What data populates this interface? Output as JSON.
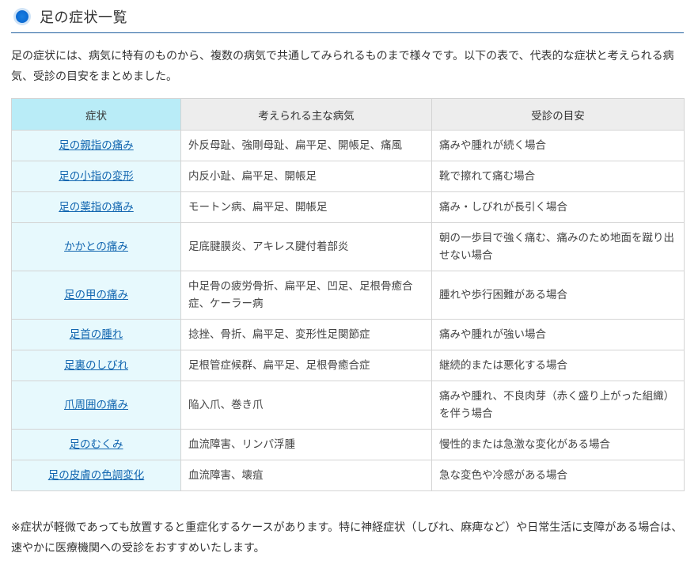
{
  "heading": {
    "title": "足の症状一覧"
  },
  "intro": "足の症状には、病気に特有のものから、複数の病気で共通してみられるものまで様々です。以下の表で、代表的な症状と考えられる病気、受診の目安をまとめました。",
  "table": {
    "headers": [
      "症状",
      "考えられる主な病気",
      "受診の目安"
    ],
    "rows": [
      {
        "symptom": "足の親指の痛み",
        "diseases": "外反母趾、強剛母趾、扁平足、開帳足、痛風",
        "guide": "痛みや腫れが続く場合"
      },
      {
        "symptom": "足の小指の変形",
        "diseases": "内反小趾、扁平足、開帳足",
        "guide": "靴で擦れて痛む場合"
      },
      {
        "symptom": "足の薬指の痛み",
        "diseases": "モートン病、扁平足、開帳足",
        "guide": "痛み・しびれが長引く場合"
      },
      {
        "symptom": "かかとの痛み",
        "diseases": "足底腱膜炎、アキレス腱付着部炎",
        "guide": "朝の一歩目で強く痛む、痛みのため地面を蹴り出せない場合"
      },
      {
        "symptom": "足の甲の痛み",
        "diseases": "中足骨の疲労骨折、扁平足、凹足、足根骨癒合症、ケーラー病",
        "guide": "腫れや歩行困難がある場合"
      },
      {
        "symptom": "足首の腫れ",
        "diseases": "捻挫、骨折、扁平足、変形性足関節症",
        "guide": "痛みや腫れが強い場合"
      },
      {
        "symptom": "足裏のしびれ",
        "diseases": "足根管症候群、扁平足、足根骨癒合症",
        "guide": "継続的または悪化する場合"
      },
      {
        "symptom": "爪周囲の痛み",
        "diseases": "陥入爪、巻き爪",
        "guide": "痛みや腫れ、不良肉芽（赤く盛り上がった組織）を伴う場合"
      },
      {
        "symptom": "足のむくみ",
        "diseases": "血流障害、リンパ浮腫",
        "guide": "慢性的または急激な変化がある場合"
      },
      {
        "symptom": "足の皮膚の色調変化",
        "diseases": "血流障害、壊疽",
        "guide": "急な変色や冷感がある場合"
      }
    ]
  },
  "note": "※症状が軽微であっても放置すると重症化するケースがあります。特に神経症状（しびれ、麻痺など）や日常生活に支障がある場合は、速やかに医療機関への受診をおすすめいたします。",
  "colors": {
    "accent": "#0e6ed6",
    "heading_rule": "#1f5f9e",
    "symptom_header_bg": "#b9ecf7",
    "symptom_cell_bg": "#e7f9fd",
    "link": "#1266b0"
  }
}
